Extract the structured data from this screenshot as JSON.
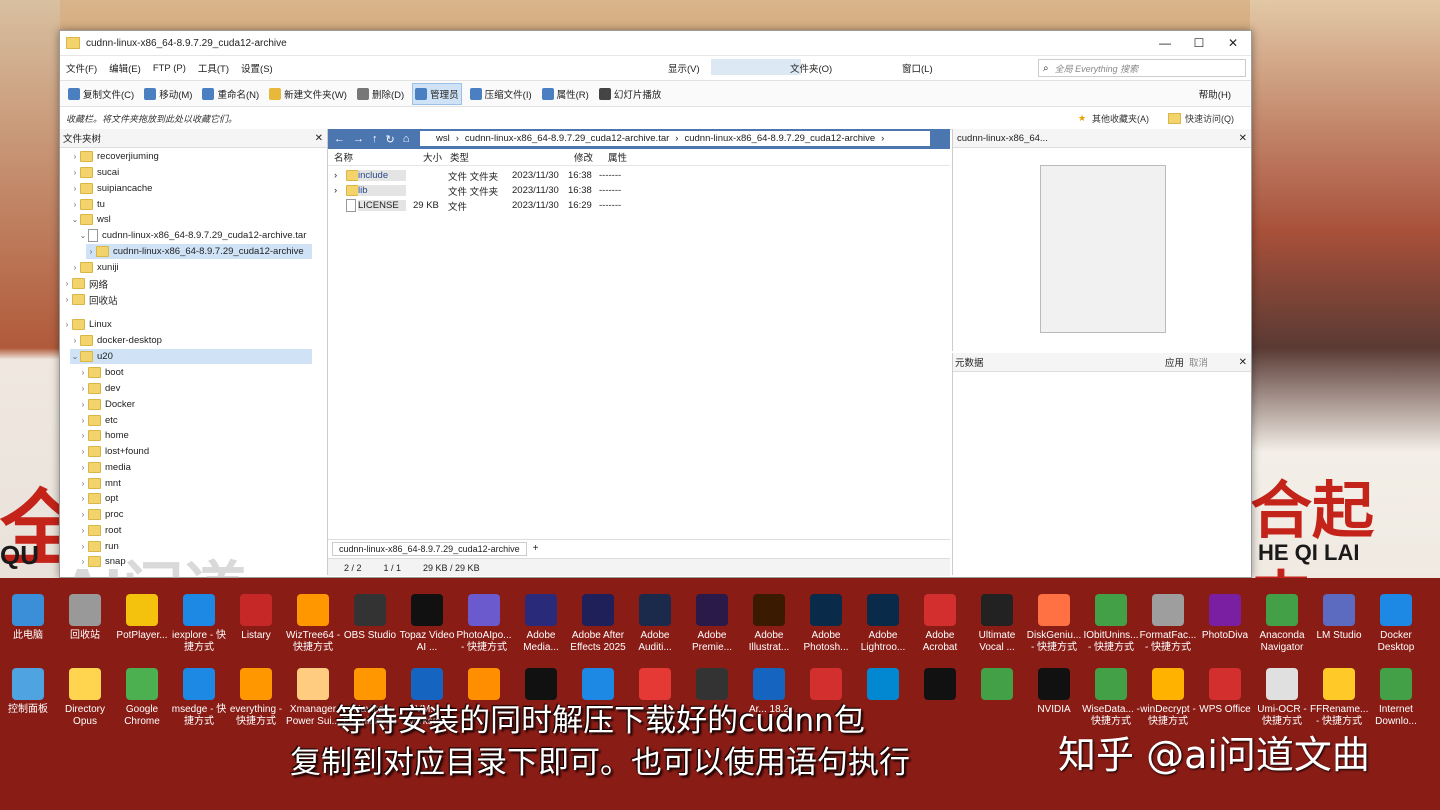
{
  "window": {
    "title": "cudnn-linux-x86_64-8.9.7.29_cuda12-archive"
  },
  "menu": [
    "文件(F)",
    "编辑(E)",
    "FTP (P)",
    "工具(T)",
    "设置(S)"
  ],
  "menu_right": {
    "display": "显示(V)",
    "folder": "文件夹(O)",
    "window": "窗口(L)",
    "search_placeholder": "全局 Everything 搜索",
    "help": "帮助(H)"
  },
  "toolbar": [
    {
      "label": "复制文件(C)",
      "color": "#4a7fc1"
    },
    {
      "label": "移动(M)",
      "color": "#4a7fc1"
    },
    {
      "label": "重命名(N)",
      "color": "#4a7fc1"
    },
    {
      "label": "新建文件夹(W)",
      "color": "#e8b83a"
    },
    {
      "label": "删除(D)",
      "color": "#777"
    },
    {
      "label": "管理员",
      "color": "#4a7fc1"
    },
    {
      "label": "压缩文件(I)",
      "color": "#4a7fc1"
    },
    {
      "label": "属性(R)",
      "color": "#4a7fc1"
    },
    {
      "label": "幻灯片播放",
      "color": "#444"
    }
  ],
  "favbar": {
    "hint": "收藏栏。将文件夹拖放到此处以收藏它们。",
    "other_fav": "其他收藏夹(A)",
    "quick": "快速访问(Q)"
  },
  "tree": {
    "title": "文件夹树",
    "items": [
      "recoverjiuming",
      "sucai",
      "suipiancache",
      "tu",
      "wsl",
      "cudnn-linux-x86_64-8.9.7.29_cuda12-archive.tar",
      "cudnn-linux-x86_64-8.9.7.29_cuda12-archive",
      "xuniji",
      "网络",
      "回收站",
      "Linux",
      "docker-desktop",
      "u20",
      "boot",
      "dev",
      "Docker",
      "etc",
      "home",
      "lost+found",
      "media",
      "mnt",
      "opt",
      "proc",
      "root",
      "run",
      "snap"
    ]
  },
  "path": [
    "wsl",
    "cudnn-linux-x86_64-8.9.7.29_cuda12-archive.tar",
    "cudnn-linux-x86_64-8.9.7.29_cuda12-archive"
  ],
  "columns": [
    "名称",
    "大小",
    "类型",
    "修改",
    "属性"
  ],
  "files": [
    {
      "name": "include",
      "size": "",
      "type": "文件 文件夹",
      "date": "2023/11/30",
      "time": "16:38",
      "attr": "-------"
    },
    {
      "name": "lib",
      "size": "",
      "type": "文件 文件夹",
      "date": "2023/11/30",
      "time": "16:38",
      "attr": "-------"
    },
    {
      "name": "LICENSE",
      "size": "29 KB",
      "type": "文件",
      "date": "2023/11/30",
      "time": "16:29",
      "attr": "-------"
    }
  ],
  "tab": "cudnn-linux-x86_64-8.9.7.29_cuda12-archive",
  "status": {
    "sel": "2 / 2",
    "files": "1 / 1",
    "size": "29 KB / 29 KB"
  },
  "preview": {
    "title": "cudnn-linux-x86_64..."
  },
  "meta": {
    "title": "元数据",
    "apply": "应用",
    "cancel": "取消"
  },
  "bg_text": {
    "left": "全",
    "right": "合起来!",
    "pinyin_left": "QU",
    "pinyin_right": "HE QI LAI"
  },
  "watermark": "AI问道",
  "desktop": [
    [
      "此电脑",
      "#3a8fd8"
    ],
    [
      "回收站",
      "#999"
    ],
    [
      "PotPlayer...",
      "#f4c20d"
    ],
    [
      "iexplore - 快捷方式",
      "#1e88e5"
    ],
    [
      "Listary",
      "#c62828"
    ],
    [
      "WizTree64 - 快捷方式",
      "#ff9800"
    ],
    [
      "OBS Studio",
      "#333"
    ],
    [
      "Topaz Video AI ...",
      "#111"
    ],
    [
      "PhotoAIpo... - 快捷方式",
      "#6a5acd"
    ],
    [
      "Adobe Media...",
      "#2a2a7a"
    ],
    [
      "Adobe After Effects 2025",
      "#1f1f5a"
    ],
    [
      "Adobe Auditi...",
      "#1b2a4a"
    ],
    [
      "Adobe Premie...",
      "#2a1a4a"
    ],
    [
      "Adobe Illustrat...",
      "#3a1a00"
    ],
    [
      "Adobe Photosh...",
      "#0a2a4a"
    ],
    [
      "Adobe Lightroo...",
      "#0a2a4a"
    ],
    [
      "Adobe Acrobat",
      "#d32f2f"
    ],
    [
      "Ultimate Vocal ...",
      "#222"
    ],
    [
      "DiskGeniu... - 快捷方式",
      "#ff7043"
    ],
    [
      "IObitUnins... - 快捷方式",
      "#43a047"
    ],
    [
      "FormatFac... - 快捷方式",
      "#9e9e9e"
    ],
    [
      "PhotoDiva",
      "#7b1fa2"
    ],
    [
      "Anaconda Navigator",
      "#43a047"
    ],
    [
      "LM Studio",
      "#5c6bc0"
    ],
    [
      "Docker Desktop",
      "#1e88e5"
    ]
  ],
  "desktop2": [
    [
      "控制面板",
      "#4fa3e0"
    ],
    [
      "Directory Opus",
      "#ffd54f"
    ],
    [
      "Google Chrome",
      "#4caf50"
    ],
    [
      "msedge - 快捷方式",
      "#1e88e5"
    ],
    [
      "everything - 快捷方式",
      "#ff9800"
    ],
    [
      "Xmanager Power Sui...",
      "#ffcc80"
    ],
    [
      "Navicat Premium 16",
      "#ff9800"
    ],
    [
      "VM... Worksta...",
      "#1565c0"
    ],
    [
      "",
      "#ff8f00"
    ],
    [
      "",
      "#111"
    ],
    [
      "",
      "#1e88e5"
    ],
    [
      "",
      "#e53935"
    ],
    [
      "",
      "#333"
    ],
    [
      "Ar... 18.2",
      "#1565c0"
    ],
    [
      "",
      "#d32f2f"
    ],
    [
      "",
      "#0288d1"
    ],
    [
      "",
      "#111"
    ],
    [
      "",
      "#43a047"
    ],
    [
      "NVIDIA",
      "#111"
    ],
    [
      "WiseData... - 快捷方式",
      "#43a047"
    ],
    [
      "winDecrypt - 快捷方式",
      "#ffb300"
    ],
    [
      "WPS Office",
      "#d32f2f"
    ],
    [
      "Umi-OCR - 快捷方式",
      "#e0e0e0"
    ],
    [
      "FFRename... - 快捷方式",
      "#ffca28"
    ],
    [
      "Internet Downlo...",
      "#43a047"
    ]
  ],
  "subtitles": {
    "line1": "等待安装的同时解压下载好的cudnn包",
    "line2": "复制到对应目录下即可。也可以使用语句执行",
    "brand": "知乎 @ai问道文曲"
  }
}
